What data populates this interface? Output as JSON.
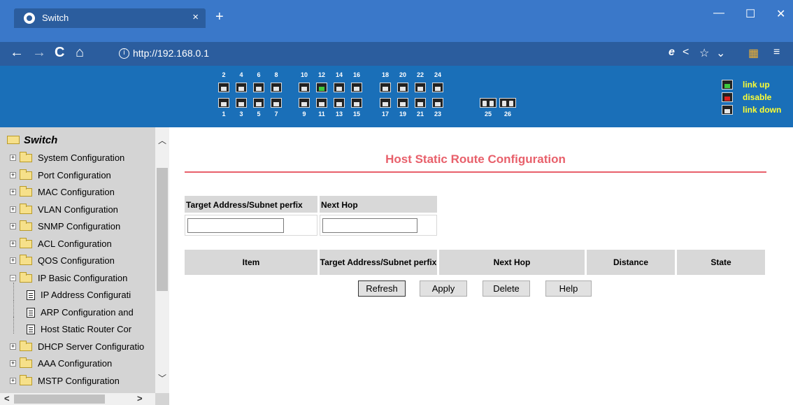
{
  "browser": {
    "tab_title": "Switch",
    "tab_close": "×",
    "new_tab": "+",
    "window_minimize": "—",
    "window_maximize": "☐",
    "window_close": "✕",
    "back": "←",
    "forward": "→",
    "reload": "C",
    "home": "⌂",
    "info_glyph": "i",
    "url": "http://192.168.0.1"
  },
  "switch_panel": {
    "top_port_numbers": [
      "2",
      "4",
      "6",
      "8",
      "10",
      "12",
      "14",
      "16",
      "18",
      "20",
      "22",
      "24"
    ],
    "bottom_port_numbers": [
      "1",
      "3",
      "5",
      "7",
      "9",
      "11",
      "13",
      "15",
      "17",
      "19",
      "21",
      "23"
    ],
    "fiber_port_numbers": [
      "25",
      "26"
    ],
    "active_port": "12",
    "legend": {
      "link_up": "link up",
      "disable": "disable",
      "link_down": "link down",
      "colors": {
        "link_up": "#3ec93e",
        "disable": "#e02020",
        "link_down": "#e6e6e6",
        "text": "#ffff33"
      }
    }
  },
  "sidebar": {
    "root": "Switch",
    "items": [
      {
        "label": "System Configuration",
        "type": "folder",
        "expander": "+"
      },
      {
        "label": "Port Configuration",
        "type": "folder",
        "expander": "+"
      },
      {
        "label": "MAC Configuration",
        "type": "folder",
        "expander": "+"
      },
      {
        "label": "VLAN Configuration",
        "type": "folder",
        "expander": "+"
      },
      {
        "label": "SNMP Configuration",
        "type": "folder",
        "expander": "+"
      },
      {
        "label": "ACL Configuration",
        "type": "folder",
        "expander": "+"
      },
      {
        "label": "QOS Configuration",
        "type": "folder",
        "expander": "+"
      },
      {
        "label": "IP Basic Configuration",
        "type": "folder-open",
        "expander": "−"
      },
      {
        "label": "IP Address Configurati",
        "type": "doc"
      },
      {
        "label": "ARP Configuration and",
        "type": "doc"
      },
      {
        "label": "Host Static Router Cor",
        "type": "doc"
      },
      {
        "label": "DHCP Server Configuratio",
        "type": "folder",
        "expander": "+"
      },
      {
        "label": "AAA Configuration",
        "type": "folder",
        "expander": "+"
      },
      {
        "label": "MSTP Configuration",
        "type": "folder",
        "expander": "+"
      }
    ]
  },
  "main": {
    "title": "Host Static Route Configuration",
    "form": {
      "target_header": "Target Address/Subnet perfix",
      "nexthop_header": "Next Hop",
      "target_value": "",
      "nexthop_value": ""
    },
    "table_headers": [
      "Item",
      "Target Address/Subnet perfix",
      "Next Hop",
      "Distance",
      "State"
    ],
    "buttons": {
      "refresh": "Refresh",
      "apply": "Apply",
      "delete": "Delete",
      "help": "Help"
    }
  }
}
